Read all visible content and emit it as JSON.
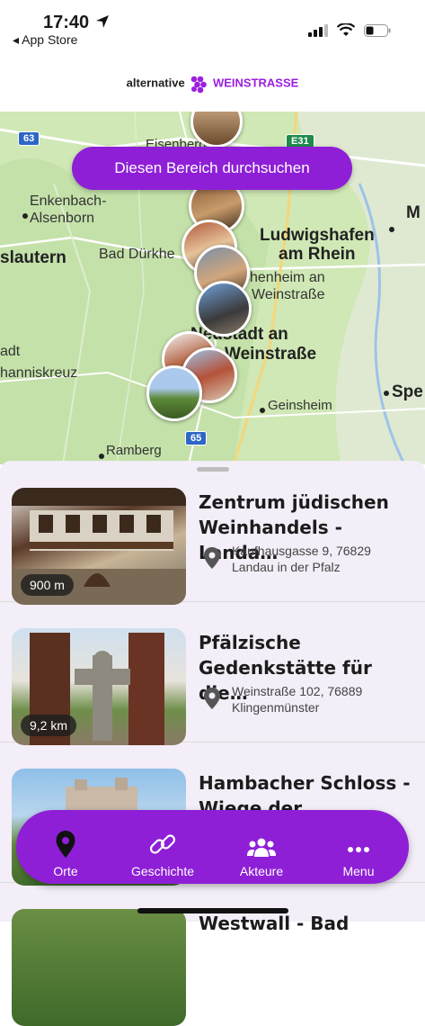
{
  "status": {
    "time": "17:40",
    "back": "◂ App Store"
  },
  "brand": {
    "part1": "alternative",
    "part2": "WEINSTRASSE"
  },
  "map": {
    "search_button": "Diesen Bereich durchsuchen",
    "labels": {
      "eisenberg": "Eisenberg",
      "enkenbach": "Enkenbach-",
      "alsenborn": "Alsenborn",
      "kaiserslautern": "slautern",
      "bad_duerkheim": "Bad Dürkhe",
      "ludwigshafen1": "Ludwigshafen",
      "ludwigshafen2": "am Rhein",
      "m": "M",
      "haßloch1": "chenheim an",
      "haßloch2": "Weinstraße",
      "neustadt1": "Neustadt an",
      "neustadt2": "Weinstraße",
      "adt": "adt",
      "johanniskreuz": "hanniskreuz",
      "geinsheim": "Geinsheim",
      "speyer": "Spe",
      "ramberg": "Ramberg"
    },
    "shields": {
      "a63": "63",
      "e31": "E31",
      "a65": "65"
    }
  },
  "places": [
    {
      "title": "Zentrum jüdischen Weinhandels - Landa…",
      "address_line1": "Kaufhausgasse 9, 76829",
      "address_line2": "Landau in der Pfalz",
      "distance": "900 m"
    },
    {
      "title": "Pfälzische Gedenkstätte für die…",
      "address_line1": "Weinstraße 102, 76889",
      "address_line2": "Klingenmünster",
      "distance": "9,2 km"
    },
    {
      "title": "Hambacher Schloss - Wiege der Demokratie",
      "address_line1": "",
      "address_line2": "",
      "distance": ""
    },
    {
      "title": "Westwall - Bad"
    }
  ],
  "tabs": {
    "orte": "Orte",
    "geschichte": "Geschichte",
    "akteure": "Akteure",
    "menu": "Menu"
  },
  "colors": {
    "accent": "#8e1fd6",
    "map_bg": "#cfe8b5"
  }
}
